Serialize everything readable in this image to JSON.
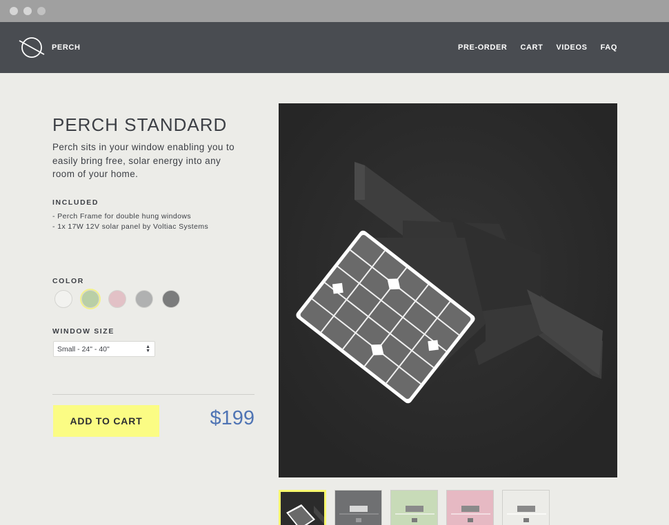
{
  "brand": {
    "name": "PERCH",
    "logo": "perch-orbit-logo"
  },
  "nav": {
    "items": [
      "PRE-ORDER",
      "CART",
      "VIDEOS",
      "FAQ"
    ]
  },
  "product": {
    "title": "PERCH STANDARD",
    "description": "Perch sits in your window enabling you to easily bring free, solar energy into any room of your home.",
    "included_heading": "INCLUDED",
    "included": [
      "- Perch Frame for double hung windows",
      "- 1x 17W 12V solar panel by Voltiac Systems"
    ],
    "color_heading": "COLOR",
    "colors": [
      {
        "hex": "#f2f2ef",
        "selected": false
      },
      {
        "hex": "#b9cfa6",
        "selected": true
      },
      {
        "hex": "#e2c1c6",
        "selected": false
      },
      {
        "hex": "#b0b1b1",
        "selected": false
      },
      {
        "hex": "#7b7c7c",
        "selected": false
      }
    ],
    "size_heading": "WINDOW SIZE",
    "size_value": "Small - 24\" - 40\"",
    "add_to_cart": "ADD TO CART",
    "price": "$199"
  },
  "gallery": {
    "thumbnails": [
      {
        "bg": "#2b2b2b",
        "selected": true
      },
      {
        "bg": "#6f7072",
        "selected": false
      },
      {
        "bg": "#c8dbb8",
        "selected": false
      },
      {
        "bg": "#e6b9c3",
        "selected": false
      },
      {
        "bg": "#ecece8",
        "selected": false
      }
    ]
  },
  "theme": {
    "nav_bg": "#494c51",
    "accent_yellow": "#fbfc84",
    "price_blue": "#4f74b4"
  }
}
